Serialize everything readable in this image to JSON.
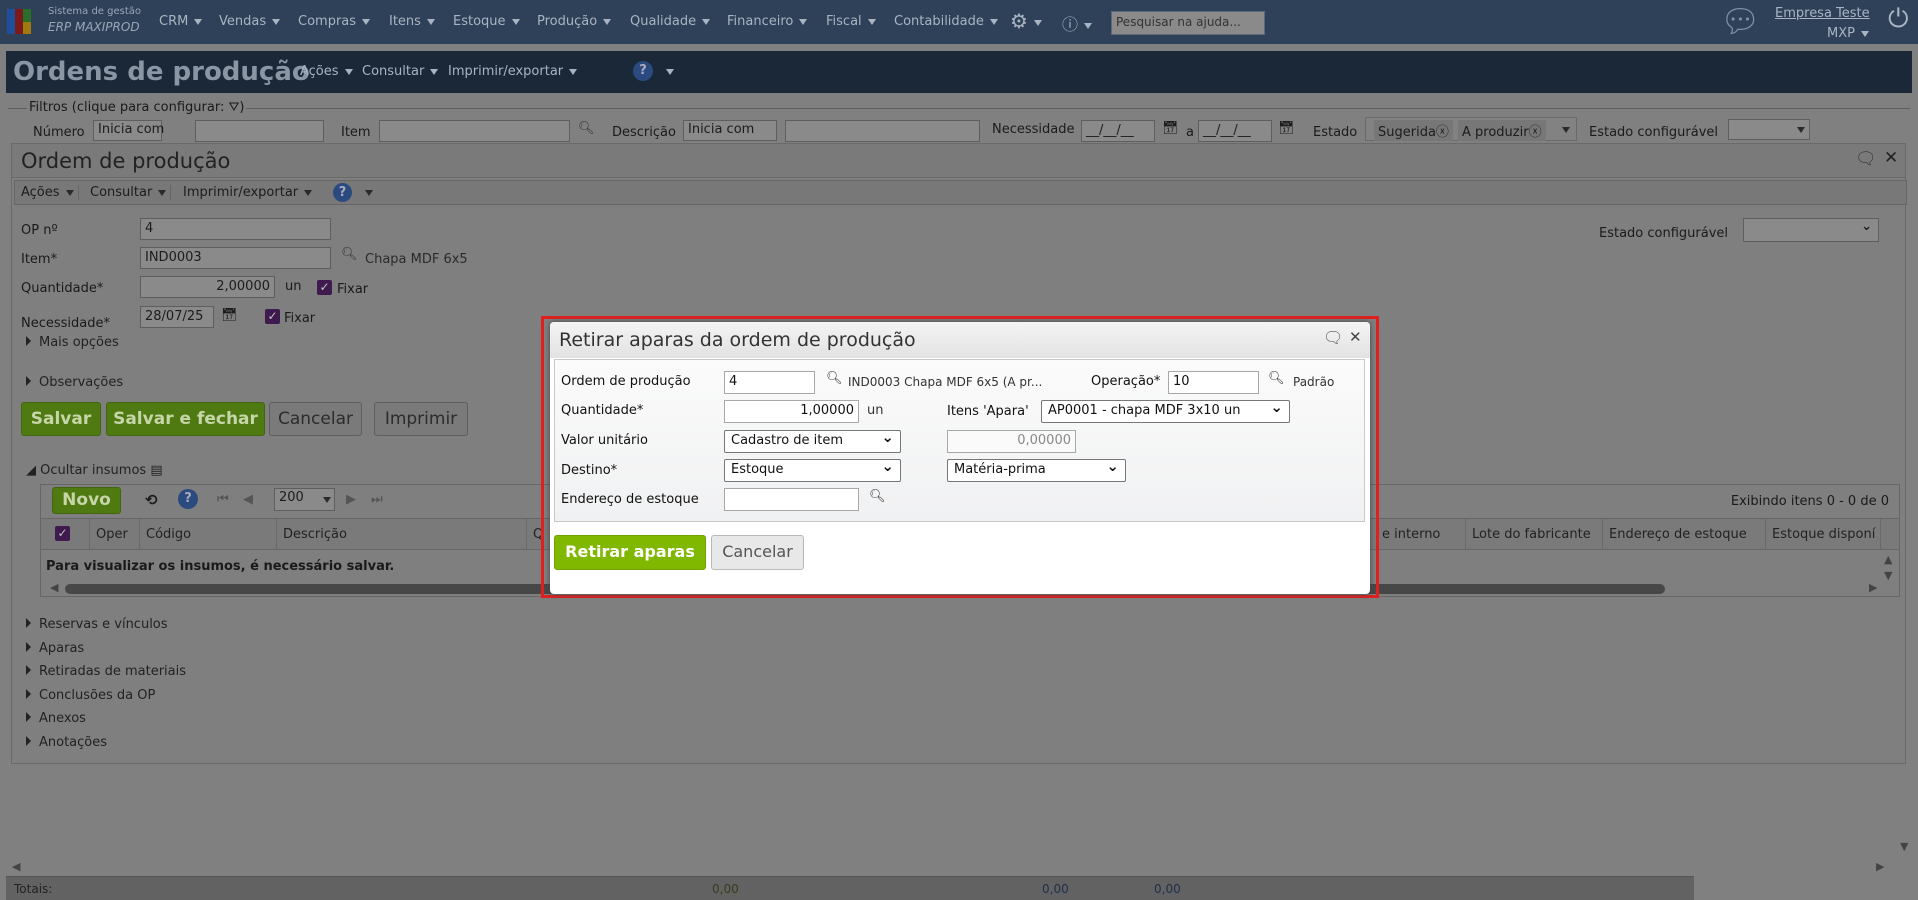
{
  "topbar": {
    "logo_line1": "Sistema de gestão",
    "logo_line2": "ERP MAXIPROD",
    "menus": [
      "CRM",
      "Vendas",
      "Compras",
      "Itens",
      "Estoque",
      "Produção",
      "Qualidade",
      "Financeiro",
      "Fiscal",
      "Contabilidade"
    ],
    "search_placeholder": "Pesquisar na ajuda...",
    "company": "Empresa Teste",
    "user": "MXP"
  },
  "header": {
    "title": "Ordens de produção",
    "menus": [
      "Ações",
      "Consultar",
      "Imprimir/exportar"
    ]
  },
  "filters": {
    "legend": "Filtros (clique para configurar:",
    "legend_end": ")",
    "numero_label": "Número",
    "numero_mode": "Inicia com",
    "item_label": "Item",
    "descricao_label": "Descrição",
    "descricao_mode": "Inicia com",
    "necessidade_label": "Necessidade",
    "date_placeholder": "__/__/__",
    "date_sep": "a",
    "estado_label": "Estado",
    "estado_tags": [
      "Sugerida",
      "A produzir"
    ],
    "estado_config_label": "Estado configurável"
  },
  "window": {
    "title": "Ordem de produção",
    "toolbar": [
      "Ações",
      "Consultar",
      "Imprimir/exportar"
    ],
    "op_label": "OP nº",
    "op_value": "4",
    "item_label": "Item*",
    "item_value": "IND0003",
    "item_desc": "Chapa MDF 6x5",
    "qty_label": "Quantidade*",
    "qty_value": "2,00000",
    "qty_unit": "un",
    "fixar": "Fixar",
    "need_label": "Necessidade*",
    "need_value": "28/07/25",
    "mais_opcoes": "Mais opções",
    "observacoes": "Observações",
    "estado_config_label": "Estado configurável",
    "buttons": {
      "save": "Salvar",
      "save_close": "Salvar e fechar",
      "cancel": "Cancelar",
      "print": "Imprimir"
    },
    "insumos": {
      "toggle": "Ocultar insumos",
      "new": "Novo",
      "page_size": "200",
      "showing": "Exibindo itens 0 - 0 de 0",
      "columns": [
        "Oper",
        "Código",
        "Descrição",
        "Q",
        "e interno",
        "Lote do fabricante",
        "Endereço de estoque",
        "Estoque disponí"
      ],
      "empty_message": "Para visualizar os insumos, é necessário salvar."
    },
    "sections": [
      "Reservas e vínculos",
      "Aparas",
      "Retiradas de materiais",
      "Conclusões da OP",
      "Anexos",
      "Anotações"
    ]
  },
  "totals": {
    "label": "Totais:",
    "values": [
      "0,00",
      "0,00",
      "0,00"
    ]
  },
  "dialog": {
    "title": "Retirar aparas da ordem de produção",
    "op_label": "Ordem de produção",
    "op_value": "4",
    "op_desc": "IND0003 Chapa MDF 6x5 (A pr...",
    "oper_label": "Operação*",
    "oper_value": "10",
    "oper_desc": "Padrão",
    "qty_label": "Quantidade*",
    "qty_value": "1,00000",
    "qty_unit": "un",
    "apara_label": "Itens 'Apara'",
    "apara_value": "AP0001 - chapa MDF 3x10 un",
    "valor_label": "Valor unitário",
    "valor_mode": "Cadastro de item",
    "valor_value": "0,00000",
    "destino_label": "Destino*",
    "destino_value": "Estoque",
    "destino_type": "Matéria-prima",
    "endereco_label": "Endereço de estoque",
    "endereco_value": "",
    "submit": "Retirar aparas",
    "cancel": "Cancelar"
  },
  "colors": {
    "highlight": "#e02020",
    "green": "#80b800",
    "topbar": "#2e4159"
  }
}
